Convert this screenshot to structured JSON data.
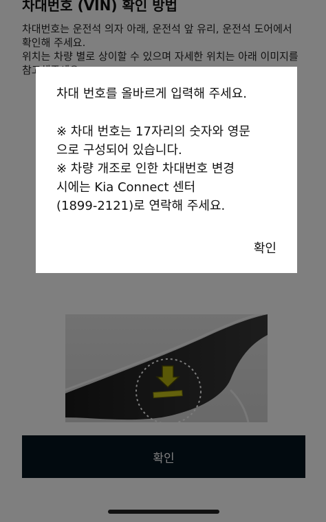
{
  "background": {
    "title": "차대번호 (VIN) 확인 방법",
    "description_1": "차대번호는 운전석 의자 아래, 운전석 앞 유리, 운전석 도어에서 확인해 주세요.",
    "description_2": "위치는 차량 별로 상이할 수 있으며 자세한 위치는 아래 이미지를 참고해주세요.",
    "confirm_label": "확인"
  },
  "dialog": {
    "message": "차대 번호를 올바르게 입력해 주세요.",
    "note_lines": [
      "※ 차대 번호는 17자리의 숫자와 영문",
      "으로 구성되어 있습니다.",
      "※ 차량 개조로 인한 차대번호 변경",
      "시에는 Kia Connect 센터",
      "(1899-2121)로 연락해 주세요."
    ],
    "ok_label": "확인"
  },
  "colors": {
    "primary_dark": "#05141f",
    "highlight_arrow": "#b5b00f"
  },
  "icons": {
    "vin_location_arrow": "down-arrow-icon"
  }
}
